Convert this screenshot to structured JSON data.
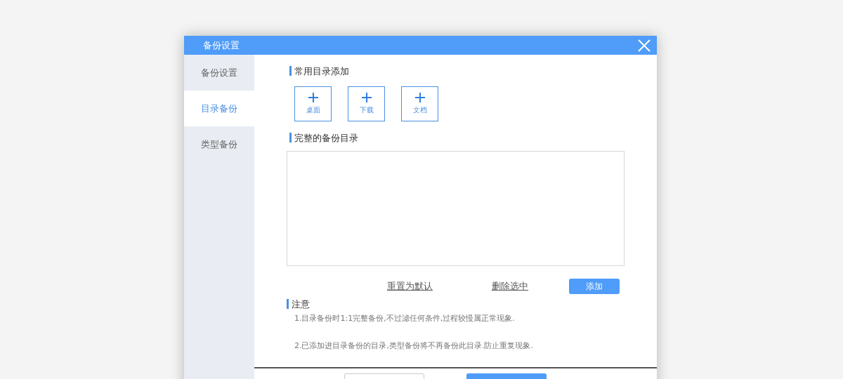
{
  "window": {
    "title": "备份设置"
  },
  "sidebar": {
    "items": [
      {
        "label": "备份设置",
        "selected": false
      },
      {
        "label": "目录备份",
        "selected": true
      },
      {
        "label": "类型备份",
        "selected": false
      }
    ]
  },
  "common_dirs": {
    "heading": "常用目录添加",
    "shortcuts": [
      {
        "label": "桌面"
      },
      {
        "label": "下载"
      },
      {
        "label": "文档"
      }
    ]
  },
  "backup_dirs": {
    "heading": "完整的备份目录"
  },
  "actions": {
    "links": [
      "重置为默认",
      "删除选中"
    ],
    "button": "添加"
  },
  "notes": {
    "heading": "注意",
    "lines": [
      "1.目录备份时1:1完整备份,不过滤任何条件,过程较慢属正常现象.",
      "2.已添加进目录备份的目录,类型备份将不再备份此目录.防止重复现象."
    ]
  }
}
